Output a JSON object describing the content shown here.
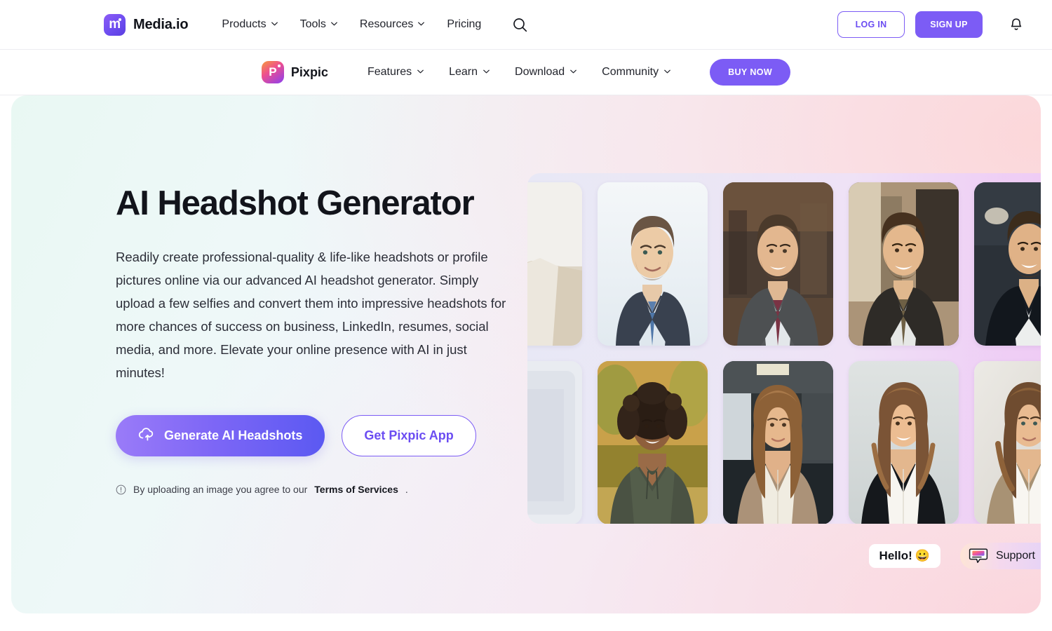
{
  "topnav": {
    "brand": {
      "name": "Media.io",
      "logo_icon": "mediaio-logo-icon",
      "logo_letter": "m"
    },
    "links": [
      {
        "label": "Products",
        "has_caret": true
      },
      {
        "label": "Tools",
        "has_caret": true
      },
      {
        "label": "Resources",
        "has_caret": true
      },
      {
        "label": "Pricing",
        "has_caret": false
      }
    ],
    "search_icon": "search-icon",
    "login_label": "LOG IN",
    "signup_label": "SIGN UP",
    "bell_icon": "notification-bell-icon"
  },
  "subnav": {
    "brand": {
      "name": "Pixpic",
      "logo_icon": "pixpic-logo-icon",
      "logo_letter": "P"
    },
    "links": [
      {
        "label": "Features",
        "has_caret": true
      },
      {
        "label": "Learn",
        "has_caret": true
      },
      {
        "label": "Download",
        "has_caret": true
      },
      {
        "label": "Community",
        "has_caret": true
      }
    ],
    "buy_label": "BUY NOW"
  },
  "hero": {
    "title": "AI Headshot Generator",
    "description": "Readily create professional-quality & life-like headshots or profile pictures online via our advanced AI headshot generator. Simply upload a few selfies and convert them into impressive headshots for more chances of success on business, LinkedIn, resumes, social media, and more. Elevate your online presence with AI in just minutes!",
    "primary_cta": "Generate AI Headshots",
    "primary_cta_icon": "cloud-upload-icon",
    "secondary_cta": "Get Pixpic App",
    "terms_icon": "info-icon",
    "terms_prefix": "By uploading an image you agree to our ",
    "terms_link": "Terms of Services",
    "terms_suffix": "."
  },
  "gallery": {
    "rows": [
      {
        "items": [
          {
            "alt": "man in beige suit headshot",
            "partial": true
          },
          {
            "alt": "man in navy suit with blue tie headshot",
            "partial": false
          },
          {
            "alt": "man in grey suit with burgundy tie headshot",
            "partial": false
          },
          {
            "alt": "man in dark brown suit with tie headshot",
            "partial": false
          },
          {
            "alt": "man in black blazer with open collar headshot",
            "partial": false
          }
        ]
      },
      {
        "items": [
          {
            "alt": "blurred portrait placeholder",
            "partial": true
          },
          {
            "alt": "woman with curly hair in green hoodie outdoors",
            "partial": false
          },
          {
            "alt": "woman with long hair in beige blazer in office",
            "partial": false
          },
          {
            "alt": "woman in black blazer with white shirt smiling",
            "partial": false
          },
          {
            "alt": "woman in tan blazer with white shirt headshot",
            "partial": false
          }
        ]
      }
    ]
  },
  "chat": {
    "hello_text": "Hello!",
    "hello_emoji": "😀",
    "support_label": "Support",
    "support_icon": "chat-bubble-icon"
  },
  "colors": {
    "accent_purple": "#7c5cf5",
    "accent_purple_dark": "#6b4df2",
    "text_dark": "#12141b",
    "hero_mint": "#e9f8f3",
    "hero_pink": "#fbdfe0",
    "gallery_violet": "#f0c7f5"
  }
}
